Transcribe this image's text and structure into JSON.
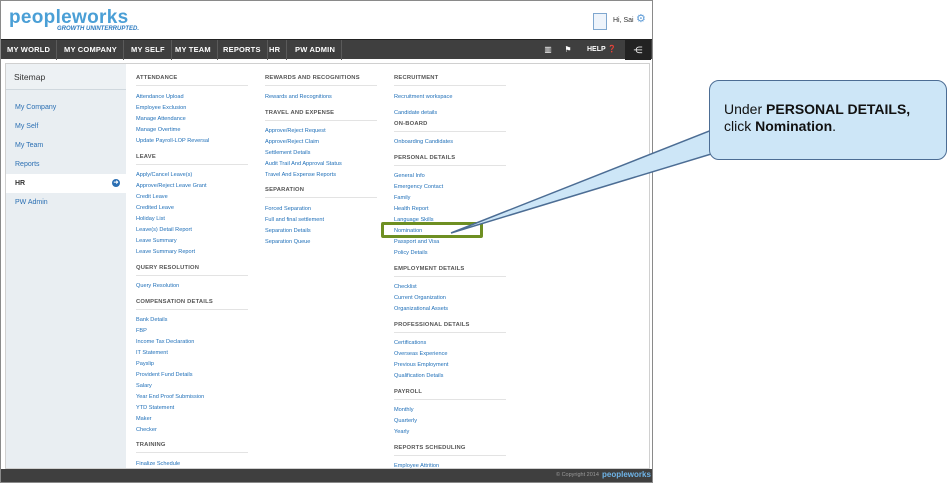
{
  "header": {
    "logo": "peopleworks",
    "tagline": "GROWTH UNINTERRUPTED.",
    "greeting": "Hi, Sai",
    "icons": {
      "avatar": "user-avatar",
      "settings": "gear-icon"
    }
  },
  "nav": {
    "items": [
      "MY WORLD",
      "MY COMPANY",
      "MY SELF",
      "MY TEAM",
      "REPORTS",
      "HR",
      "PW ADMIN"
    ],
    "help": "HELP",
    "icons": [
      "book-icon",
      "flag-icon",
      "help-icon",
      "menu-toggle-icon"
    ]
  },
  "sidebar": {
    "title": "Sitemap",
    "items": [
      "My Company",
      "My Self",
      "My Team",
      "Reports",
      "HR",
      "PW Admin"
    ],
    "active": "HR"
  },
  "columns": {
    "col1": {
      "attendance": {
        "title": "ATTENDANCE",
        "links": [
          "Attendance Upload",
          "Employee Exclusion",
          "Manage Attendance",
          "Manage Overtime",
          "Update Payroll-LOP Reversal"
        ]
      },
      "leave": {
        "title": "LEAVE",
        "links": [
          "Apply/Cancel Leave(s)",
          "Approve/Reject Leave Grant",
          "Credit Leave",
          "Credited Leave",
          "Holiday List",
          "Leave(s) Detail Report",
          "Leave Summary",
          "Leave Summary Report"
        ]
      },
      "query": {
        "title": "QUERY RESOLUTION",
        "links": [
          "Query Resolution"
        ]
      },
      "comp": {
        "title": "COMPENSATION DETAILS",
        "links": [
          "Bank Details",
          "FBP",
          "Income Tax Declaration",
          "IT Statement",
          "Payslip",
          "Provident Fund Details",
          "Salary",
          "Year End Proof Submission",
          "YTD Statement",
          "Maker",
          "Checker"
        ]
      },
      "training": {
        "title": "TRAINING",
        "links": [
          "Finalize Schedule"
        ]
      }
    },
    "col2": {
      "rewards": {
        "title": "REWARDS AND RECOGNITIONS",
        "links": [
          "Rewards and Recognitions"
        ]
      },
      "travel": {
        "title": "TRAVEL AND EXPENSE",
        "links": [
          "Approve/Reject Request",
          "Approve/Reject Claim",
          "Settlement Details",
          "Audit Trail And Approval Status",
          "Travel And Expense Reports"
        ]
      },
      "separation": {
        "title": "SEPARATION",
        "links": [
          "Forced Separation",
          "Full and final settlement",
          "Separation Details",
          "Separation Queue"
        ]
      }
    },
    "col3": {
      "recruitment": {
        "title": "RECRUITMENT",
        "links": [
          "Recruitment workspace"
        ]
      },
      "candidate": {
        "links": [
          "Candidate details"
        ]
      },
      "onboard": {
        "title": "ON-BOARD",
        "links": [
          "Onboarding Candidates"
        ]
      },
      "personal": {
        "title": "PERSONAL DETAILS",
        "links": [
          "General Info",
          "Emergency Contact",
          "Family",
          "Health Report",
          "Language Skills",
          "Nomination",
          "Passport and Visa",
          "Policy Details"
        ]
      },
      "employment": {
        "title": "EMPLOYMENT DETAILS",
        "links": [
          "Checklist",
          "Current Organization",
          "Organizational Assets"
        ]
      },
      "professional": {
        "title": "PROFESSIONAL DETAILS",
        "links": [
          "Certifications",
          "Overseas Experience",
          "Previous Employment",
          "Qualification Details"
        ]
      },
      "payroll": {
        "title": "PAYROLL",
        "links": [
          "Monthly",
          "Quarterly",
          "Yearly"
        ]
      },
      "scheduling": {
        "title": "REPORTS SCHEDULING",
        "links": [
          "Employee Attrition"
        ]
      }
    }
  },
  "footer": {
    "copyright": "© Copyright 2014",
    "logo": "peopleworks"
  },
  "callout": {
    "pre": "Under ",
    "bold1": "PERSONAL DETAILS,",
    "mid": " click ",
    "bold2": "Nomination",
    "post": "."
  },
  "colors": {
    "nav": "#3f3f3f",
    "link": "#1f6fb8",
    "highlight": "#6e8f22",
    "callout": "#cde6f7"
  }
}
